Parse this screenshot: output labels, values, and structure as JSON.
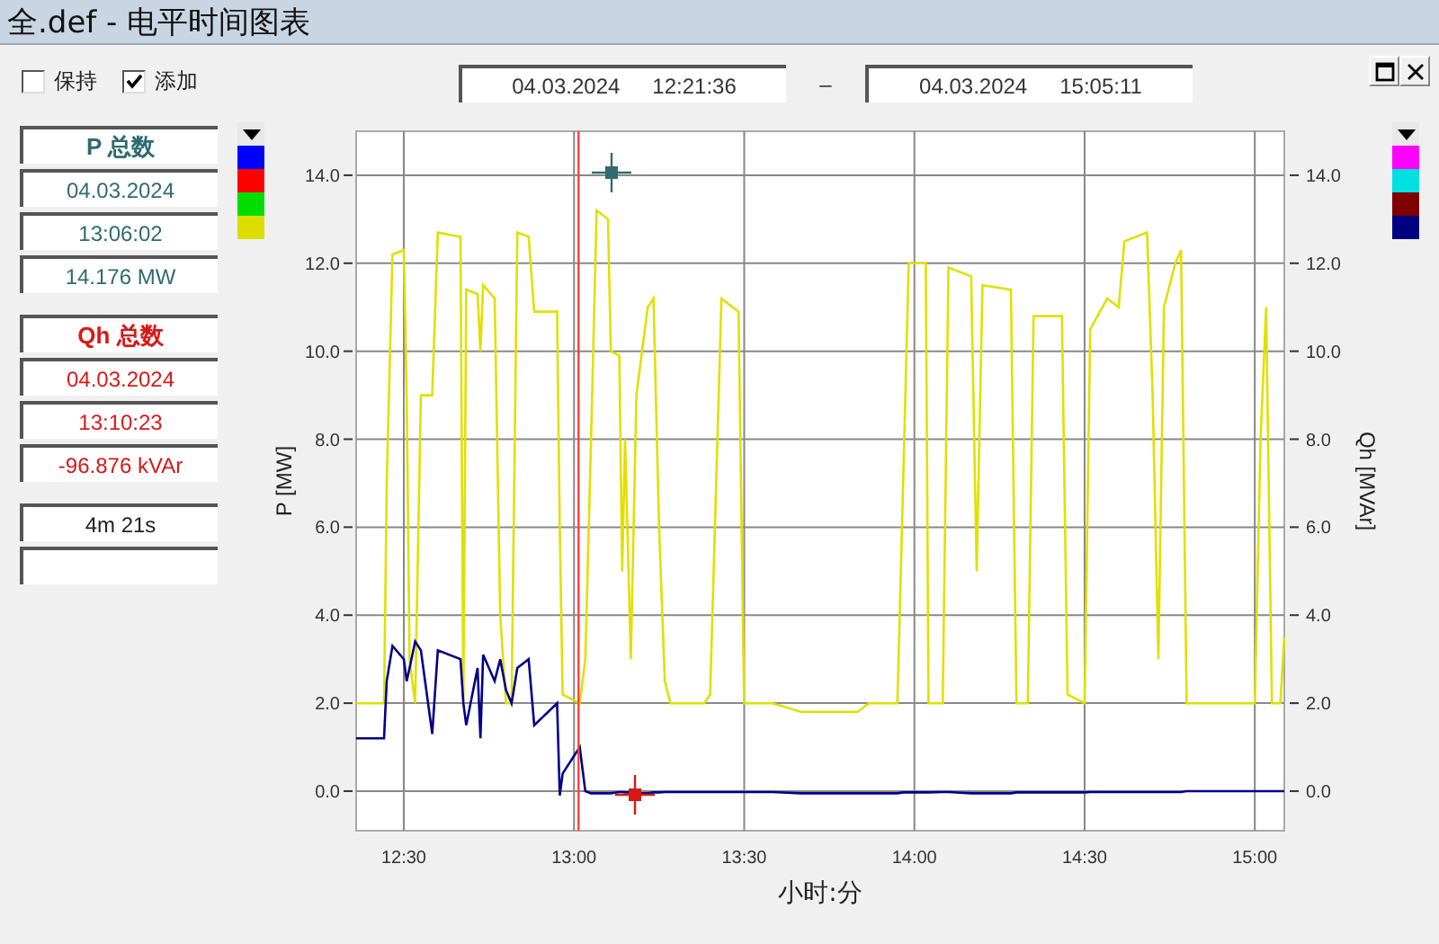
{
  "window": {
    "title": "全.def - 电平时间图表"
  },
  "options": [
    {
      "label": "保持",
      "checked": false
    },
    {
      "label": "添加",
      "checked": true
    }
  ],
  "range": {
    "from": {
      "date": "04.03.2024",
      "time": "12:21:36"
    },
    "separator": "–",
    "to": {
      "date": "04.03.2024",
      "time": "15:05:11"
    }
  },
  "cursors": [
    {
      "title": "P 总数",
      "color": "#2f6b70",
      "date": "04.03.2024",
      "time": "13:06:02",
      "value": "14.176 MW"
    },
    {
      "title": "Qh 总数",
      "color": "#d81818",
      "date": "04.03.2024",
      "time": "13:10:23",
      "value": "-96.876 kVAr"
    }
  ],
  "interval": {
    "value": "4m 21s"
  },
  "legend_left": [
    {
      "color": "#0000ff"
    },
    {
      "color": "#ff0000"
    },
    {
      "color": "#00dd00"
    },
    {
      "color": "#dddd00"
    }
  ],
  "legend_right": [
    {
      "color": "#ff00ff"
    },
    {
      "color": "#00e0e0"
    },
    {
      "color": "#800000"
    },
    {
      "color": "#000080"
    }
  ],
  "chart": {
    "chart_data": {
      "type": "line",
      "xlabel": "小时:分",
      "ylabel": "P [MW]",
      "y2label": "Qh [MVAr]",
      "xlim": [
        12.36,
        15.0867
      ],
      "ylim": [
        -0.9,
        15.0
      ],
      "y2lim": [
        -0.9,
        15.0
      ],
      "xticks": [
        {
          "value": 12.5,
          "label": "12:30"
        },
        {
          "value": 13,
          "label": "13:00"
        },
        {
          "value": 13.5,
          "label": "13:30"
        },
        {
          "value": 14,
          "label": "14:00"
        },
        {
          "value": 14.5,
          "label": "14:30"
        },
        {
          "value": 15,
          "label": "15:00"
        }
      ],
      "yticks": [
        {
          "value": 0,
          "label": "0.0"
        },
        {
          "value": 2,
          "label": "2.0"
        },
        {
          "value": 4,
          "label": "4.0"
        },
        {
          "value": 6,
          "label": "6.0"
        },
        {
          "value": 8,
          "label": "8.0"
        },
        {
          "value": 10,
          "label": "10.0"
        },
        {
          "value": 12,
          "label": "12.0"
        },
        {
          "value": 14,
          "label": "14.0"
        }
      ],
      "y2ticks": [
        {
          "value": 0,
          "label": "0.0"
        },
        {
          "value": 2,
          "label": "2.0"
        },
        {
          "value": 4,
          "label": "4.0"
        },
        {
          "value": 6,
          "label": "6.0"
        },
        {
          "value": 8,
          "label": "8.0"
        },
        {
          "value": 10,
          "label": "10.0"
        },
        {
          "value": 12,
          "label": "12.0"
        },
        {
          "value": 14,
          "label": "14.0"
        }
      ],
      "x": [
        12.36,
        12.4417,
        12.45,
        12.4667,
        12.5,
        12.5083,
        12.5167,
        12.5333,
        12.55,
        12.5833,
        12.6,
        12.6667,
        12.675,
        12.6833,
        12.7167,
        12.725,
        12.7333,
        12.7667,
        12.7833,
        12.8,
        12.8167,
        12.8333,
        12.8667,
        12.8833,
        12.95,
        12.9583,
        12.9667,
        13.0167,
        13.0333,
        13.05,
        13.0667,
        13.1,
        13.1083,
        13.1333,
        13.1417,
        13.15,
        13.1667,
        13.1833,
        13.2167,
        13.2333,
        13.25,
        13.2667,
        13.2833,
        13.3833,
        13.4,
        13.4333,
        13.4833,
        13.5,
        13.5833,
        13.6667,
        13.8333,
        13.8667,
        13.95,
        13.9667,
        13.9833,
        14.0333,
        14.0417,
        14.0833,
        14.1,
        14.1667,
        14.1833,
        14.2,
        14.2833,
        14.3,
        14.3333,
        14.35,
        14.4333,
        14.45,
        14.5,
        14.5167,
        14.5667,
        14.6,
        14.6167,
        14.6833,
        14.7,
        14.7167,
        14.7333,
        14.7667,
        14.7833,
        14.8,
        14.9667,
        15.0,
        15.0167,
        15.0333,
        15.05,
        15.075,
        15.0867
      ],
      "series": [
        {
          "color": "#e0e000",
          "values": [
            2.0,
            2.0,
            7,
            12.2,
            12.3,
            9,
            3,
            2,
            9,
            9,
            12.7,
            12.6,
            2,
            11.4,
            11.3,
            10,
            11.5,
            11.2,
            4,
            2,
            2,
            12.7,
            12.6,
            10.9,
            10.9,
            6,
            2.2,
            2.0,
            3,
            8,
            13.2,
            13.0,
            10,
            9.9,
            5,
            8,
            3,
            9,
            11,
            11.2,
            6,
            2.5,
            2.0,
            2.0,
            2.2,
            11.2,
            10.9,
            2,
            2,
            1.8,
            1.8,
            2,
            2,
            7,
            12.0,
            12.0,
            2,
            2,
            11.9,
            11.7,
            5,
            11.5,
            11.4,
            2,
            2,
            10.8,
            10.8,
            2.2,
            2,
            10.5,
            11.2,
            11,
            12.5,
            12.7,
            9,
            3,
            11,
            12.0,
            12.3,
            2.0,
            2.0,
            2.0,
            8,
            11,
            2.0,
            2.0,
            3.5
          ]
        },
        {
          "color": "#00008b",
          "values": [
            1.2,
            1.2,
            2.5,
            3.3,
            3.0,
            2.5,
            2.8,
            3.4,
            3.2,
            1.3,
            3.2,
            3.0,
            2.0,
            1.5,
            2.8,
            1.2,
            3.1,
            2.5,
            3.0,
            2.3,
            2.0,
            2.8,
            3.0,
            1.5,
            2.0,
            -0.1,
            0.4,
            1.0,
            0.0,
            -0.05,
            -0.05,
            -0.05,
            -0.05,
            -0.02,
            -0.02,
            -0.03,
            -0.03,
            -0.05,
            -0.05,
            -0.03,
            -0.03,
            -0.02,
            -0.02,
            -0.02,
            -0.02,
            -0.02,
            -0.02,
            -0.02,
            -0.02,
            -0.05,
            -0.05,
            -0.05,
            -0.05,
            -0.03,
            -0.03,
            -0.03,
            -0.03,
            -0.02,
            -0.02,
            -0.05,
            -0.05,
            -0.05,
            -0.05,
            -0.03,
            -0.03,
            -0.03,
            -0.03,
            -0.03,
            -0.03,
            -0.02,
            -0.02,
            -0.02,
            -0.02,
            -0.02,
            -0.02,
            -0.02,
            -0.02,
            -0.02,
            -0.02,
            0.0,
            0.0,
            0.0,
            0.0,
            0.0,
            0.0,
            0.0,
            0.0
          ]
        }
      ],
      "grid": true,
      "ref_lines": [
        {
          "axis": "x",
          "value": 13.0133
        }
      ]
    }
  }
}
